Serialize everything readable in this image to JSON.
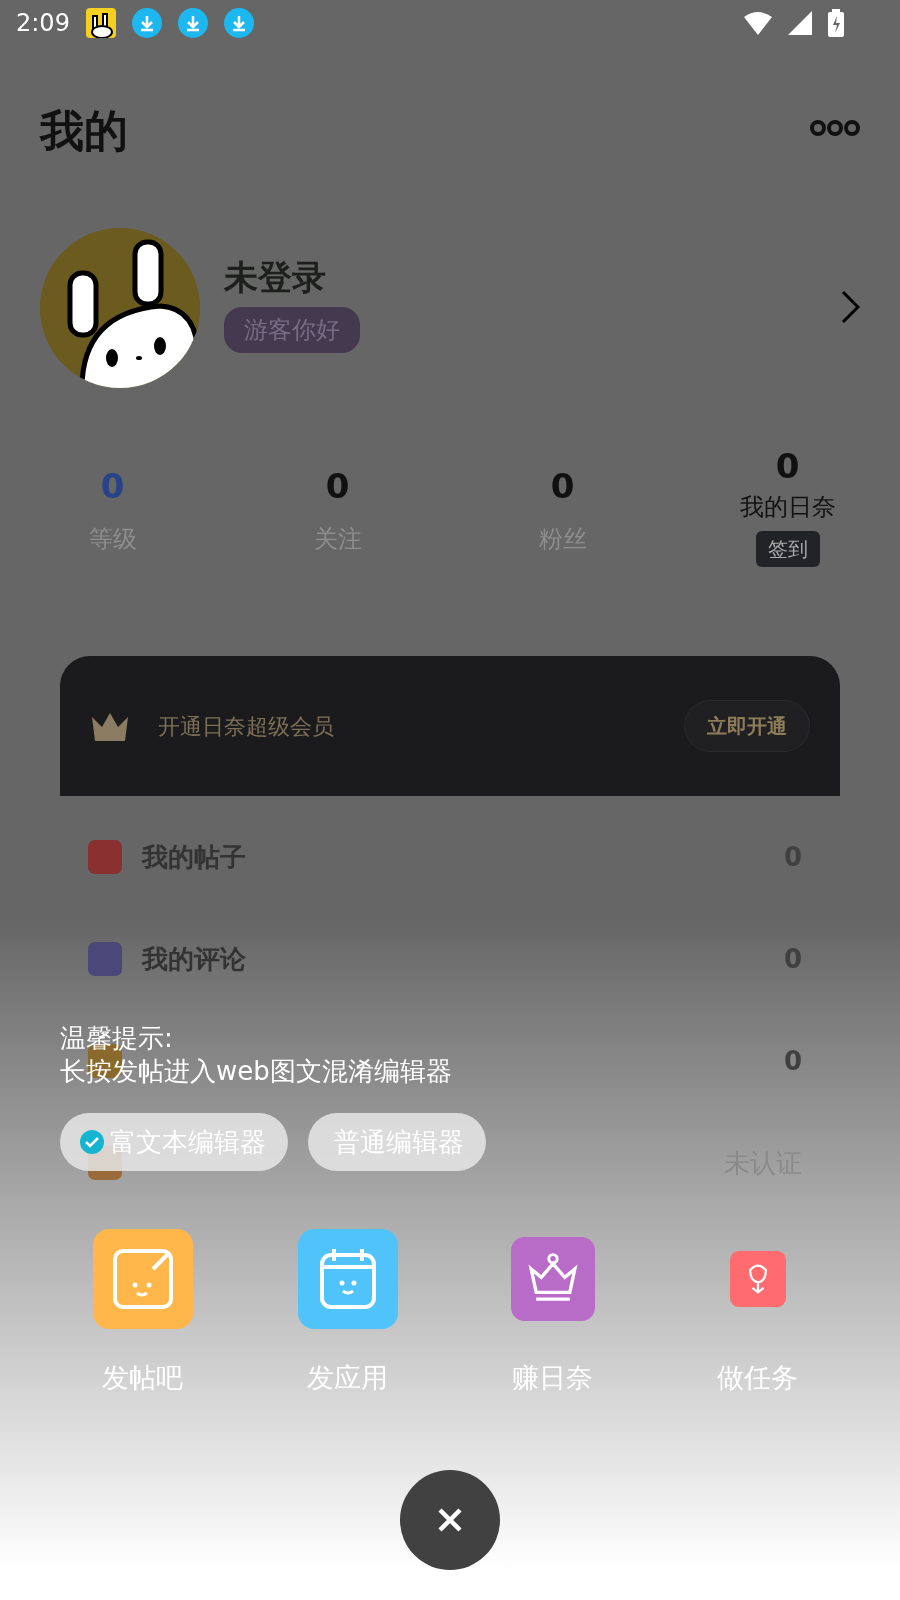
{
  "status_bar": {
    "time": "2:09"
  },
  "header": {
    "title": "我的"
  },
  "profile": {
    "name": "未登录",
    "greeting": "游客你好"
  },
  "stats": [
    {
      "value": "0",
      "label": "等级",
      "kind": "level"
    },
    {
      "value": "0",
      "label": "关注",
      "kind": "plain"
    },
    {
      "value": "0",
      "label": "粉丝",
      "kind": "plain"
    },
    {
      "value": "0",
      "label": "我的日奈",
      "kind": "checkin",
      "action": "签到"
    }
  ],
  "vip_banner": {
    "text": "开通日奈超级会员",
    "button": "立即开通"
  },
  "menu": [
    {
      "label": "我的帖子",
      "value": "0",
      "color": "#8a3030"
    },
    {
      "label": "我的评论",
      "value": "0",
      "color": "#4a4878"
    },
    {
      "value": "0",
      "color": "#8a6a2a"
    },
    {
      "value": "未认证",
      "color": "#9a6a3a"
    }
  ],
  "tip": {
    "title": "温馨提示:",
    "text": "长按发帖进入web图文混淆编辑器"
  },
  "editor_options": [
    {
      "label": "富文本编辑器",
      "selected": true
    },
    {
      "label": "普通编辑器",
      "selected": false
    }
  ],
  "actions": [
    {
      "label": "发帖吧",
      "kind": "post",
      "color": "#ffb74c"
    },
    {
      "label": "发应用",
      "kind": "app",
      "color": "#50c4fa"
    },
    {
      "label": "赚日奈",
      "kind": "earn",
      "color": "#b96bc8"
    },
    {
      "label": "做任务",
      "kind": "task",
      "color": "#ff6b6e"
    }
  ]
}
